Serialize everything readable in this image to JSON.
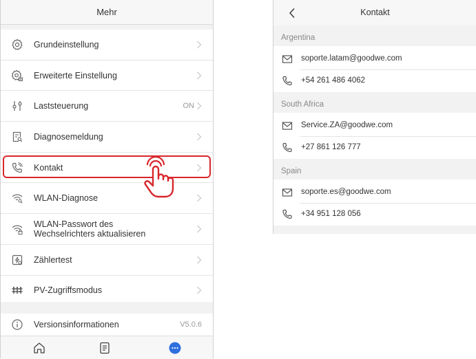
{
  "left_screen": {
    "title": "Mehr",
    "items": [
      {
        "label": "Grundeinstellung",
        "icon": "settings-gear-icon",
        "value": ""
      },
      {
        "label": "Erweiterte Einstellung",
        "icon": "advanced-settings-icon",
        "value": ""
      },
      {
        "label": "Laststeuerung",
        "icon": "load-control-icon",
        "value": "ON"
      },
      {
        "label": "Diagnosemeldung",
        "icon": "diagnosis-document-icon",
        "value": ""
      },
      {
        "label": "Kontakt",
        "icon": "phone-contact-icon",
        "value": ""
      },
      {
        "label": "WLAN-Diagnose",
        "icon": "wifi-search-icon",
        "value": ""
      },
      {
        "label_line1": "WLAN-Passwort des",
        "label_line2": "Wechselrichters aktualisieren",
        "icon": "wifi-lock-icon",
        "value": ""
      },
      {
        "label": "Zählertest",
        "icon": "meter-test-icon",
        "value": ""
      },
      {
        "label": "PV-Zugriffsmodus",
        "icon": "pv-access-icon",
        "value": ""
      }
    ],
    "version": {
      "label": "Versionsinformationen",
      "value": "V5.0.6",
      "icon": "info-icon"
    },
    "tabs": [
      {
        "icon": "home-icon"
      },
      {
        "icon": "document-icon"
      },
      {
        "icon": "more-dots-icon",
        "active": true
      }
    ],
    "highlight_color": "#d9262c",
    "active_tab_color": "#2f6fde"
  },
  "right_screen": {
    "title": "Kontakt",
    "sections": [
      {
        "region": "Argentina",
        "email": "soporte.latam@goodwe.com",
        "phone": "+54 261 486 4062"
      },
      {
        "region": "South Africa",
        "email": "Service.ZA@goodwe.com",
        "phone": "+27 861 126 777"
      },
      {
        "region": "Spain",
        "email": "soporte.es@goodwe.com",
        "phone": "+34 951 128 056"
      }
    ]
  }
}
